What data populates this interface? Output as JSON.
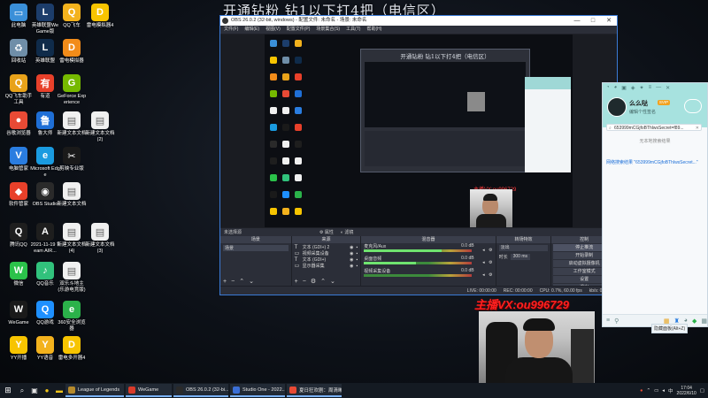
{
  "stream_title": "开通钻粉 钻1以下打4把（电信区）",
  "desktop_icons": [
    {
      "label": "此电脑",
      "color": "#3a8fd8",
      "glyph": "▭"
    },
    {
      "label": "英雄联盟WeGame版",
      "color": "#1c3d6b",
      "glyph": "L"
    },
    {
      "label": "QQ飞车",
      "color": "#f3b21d",
      "glyph": "Q"
    },
    {
      "label": "雷电模拟器4",
      "color": "#f7c400",
      "glyph": "D"
    },
    {
      "label": "回收站",
      "color": "#6f8ea8",
      "glyph": "♻"
    },
    {
      "label": "英雄联盟",
      "color": "#0f2b4a",
      "glyph": "L"
    },
    {
      "label": "雷电模拟器",
      "color": "#f28c1a",
      "glyph": "D"
    },
    {
      "label": "QQ飞车助手工具",
      "color": "#e8a21a",
      "glyph": "Q"
    },
    {
      "label": "有道",
      "color": "#e8402a",
      "glyph": "有"
    },
    {
      "label": "GeForce Experience",
      "color": "#76b900",
      "glyph": "G"
    },
    {
      "label": "谷歌浏览器",
      "color": "#e84a35",
      "glyph": "●"
    },
    {
      "label": "鲁大师",
      "color": "#1f6fd6",
      "glyph": "鲁"
    },
    {
      "label": "新建文本文档",
      "color": "#f0f0f0",
      "glyph": "▤"
    },
    {
      "label": "新建文本文档(2)",
      "color": "#f0f0f0",
      "glyph": "▤"
    },
    {
      "label": "电脑管家",
      "color": "#2a7de0",
      "glyph": "V"
    },
    {
      "label": "Microsoft Edge",
      "color": "#1a9be0",
      "glyph": "e"
    },
    {
      "label": "剪映专业版",
      "color": "#1a1a1a",
      "glyph": "✂"
    },
    {
      "label": "软件管家",
      "color": "#e8402a",
      "glyph": "◆"
    },
    {
      "label": "OBS Studio",
      "color": "#2a2a2a",
      "glyph": "◉"
    },
    {
      "label": "新建文本文档",
      "color": "#f0f0f0",
      "glyph": "▤"
    },
    {
      "label": "腾讯QQ",
      "color": "#1e1e1e",
      "glyph": "Q"
    },
    {
      "label": "2021-11-19 Team AIR...",
      "color": "#1e1e1e",
      "glyph": "A"
    },
    {
      "label": "新建文本文档(4)",
      "color": "#f0f0f0",
      "glyph": "▤"
    },
    {
      "label": "新建文本文档(3)",
      "color": "#f0f0f0",
      "glyph": "▤"
    },
    {
      "label": "微信",
      "color": "#2bc24a",
      "glyph": "W"
    },
    {
      "label": "QQ音乐",
      "color": "#31c27c",
      "glyph": "♪"
    },
    {
      "label": "双乐斗地主(乐游电竞版)",
      "color": "#f0f0f0",
      "glyph": "▤"
    },
    {
      "label": "WeGame",
      "color": "#1a1a1a",
      "glyph": "W"
    },
    {
      "label": "QQ游戏",
      "color": "#1e90ff",
      "glyph": "Q"
    },
    {
      "label": "360安全浏览器",
      "color": "#2bb24a",
      "glyph": "e"
    },
    {
      "label": "YY开播",
      "color": "#f7c400",
      "glyph": "Y"
    },
    {
      "label": "YY语音",
      "color": "#f3b21d",
      "glyph": "Y"
    },
    {
      "label": "雷电多开器4",
      "color": "#f7c400",
      "glyph": "D"
    }
  ],
  "obs": {
    "window_title": "OBS 26.0.2 (32-bit, windows) - 配置文件: 未命名 - 场景: 未命名",
    "menu": [
      "文件(F)",
      "编辑(E)",
      "视图(V)",
      "配置文件(P)",
      "场景集合(S)",
      "工具(T)",
      "帮助(H)"
    ],
    "nested_title": "开通钻粉 钻1以下打4把（电信区）",
    "nested_overlay": "主播VX:ou996729",
    "no_source_label": "未选择源",
    "props_label": "属性",
    "filters_label": "滤镜",
    "docks": {
      "scenes": {
        "header": "场景",
        "items": [
          "场景"
        ]
      },
      "sources": {
        "header": "来源",
        "items": [
          {
            "glyph": "T",
            "label": "文本 (GDI+) 2"
          },
          {
            "glyph": "▭",
            "label": "视频采集设备"
          },
          {
            "glyph": "T",
            "label": "文本 (GDI+)"
          },
          {
            "glyph": "▭",
            "label": "显示器采集"
          }
        ]
      },
      "mixer": {
        "header": "混音器",
        "channels": [
          {
            "label": "麦克风/Aux",
            "db": "0.0 dB",
            "level": 0.72
          },
          {
            "label": "桌面音频",
            "db": "0.0 dB",
            "level": 0.48
          },
          {
            "label": "视频采集设备",
            "db": "0.0 dB",
            "level": 0.0
          }
        ]
      },
      "transitions": {
        "header": "转场特效",
        "type": "淡出",
        "duration_label": "时长",
        "duration": "300 ms"
      },
      "controls": {
        "header": "控制",
        "buttons": [
          "停止推流",
          "开始录制",
          "启动虚拟摄像机",
          "工作室模式",
          "设置",
          "退出"
        ]
      }
    },
    "status": {
      "live": "LIVE: 00:00:00",
      "rec": "REC: 00:00:00",
      "cpu": "CPU: 0.7%, 60.00 fps",
      "kbps": "kb/s: 0 kb/s"
    }
  },
  "chat": {
    "name": "么么哒",
    "vip": "SVIP",
    "subtitle": "编辑个性签名",
    "search_value": "653999mCGjfoBThlwsSecret=f89...",
    "empty_text": "无本地搜索结果",
    "link_text": "网络搜索结果 \"653999mCGjfoBThlwsSecret...\"",
    "hidden_label": "隐藏面板(Alt+Z)"
  },
  "streamer_overlay": "主播VX:ou996729",
  "taskbar": {
    "apps": [
      {
        "label": "League of Legends",
        "color": "#b58a2c",
        "open": true
      },
      {
        "label": "WeGame",
        "color": "#d93a2a",
        "open": true
      },
      {
        "label": "OBS 26.0.2 (32-bi...",
        "color": "#2a2a2a",
        "open": true
      },
      {
        "label": "Studio One - 2022...",
        "color": "#3b6fd6",
        "open": true
      },
      {
        "label": "夏日狂欢剧：周清晰...",
        "color": "#e84a35",
        "open": true
      }
    ],
    "time": "17:04",
    "date": "2022/6/10"
  }
}
